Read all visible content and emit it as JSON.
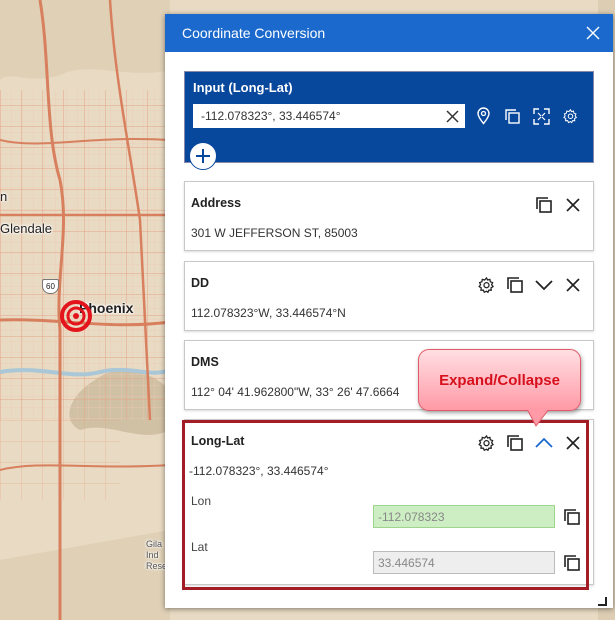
{
  "map": {
    "labels": {
      "glendale": "Glendale",
      "phoenix": "Phoenix",
      "left_edge": "n",
      "hwy": "60",
      "small_lines": [
        "Gila",
        "Ind",
        "Rese"
      ]
    }
  },
  "widget": {
    "title": "Coordinate Conversion",
    "input_panel": {
      "label": "Input (Long-Lat)",
      "value": "-112.078323°, 33.446574°"
    },
    "cards": {
      "address": {
        "title": "Address",
        "value": "301 W JEFFERSON ST, 85003"
      },
      "dd": {
        "title": "DD",
        "value": "112.078323°W, 33.446574°N"
      },
      "dms": {
        "title": "DMS",
        "value": "112° 04' 41.962800\"W, 33° 26' 47.6664"
      },
      "longlat": {
        "title": "Long-Lat",
        "value": "-112.078323°, 33.446574°",
        "lon_label": "Lon",
        "lon_value": "-112.078323",
        "lat_label": "Lat",
        "lat_value": "33.446574"
      }
    }
  },
  "callout": {
    "text": "Expand/Collapse"
  },
  "colors": {
    "header": "#1b69cc",
    "input_panel": "#07479c",
    "highlight_border": "#a31d27",
    "callout_text": "#d6101c",
    "lon_field_bg": "#cdeec2",
    "lat_field_bg": "#eeeeee"
  }
}
